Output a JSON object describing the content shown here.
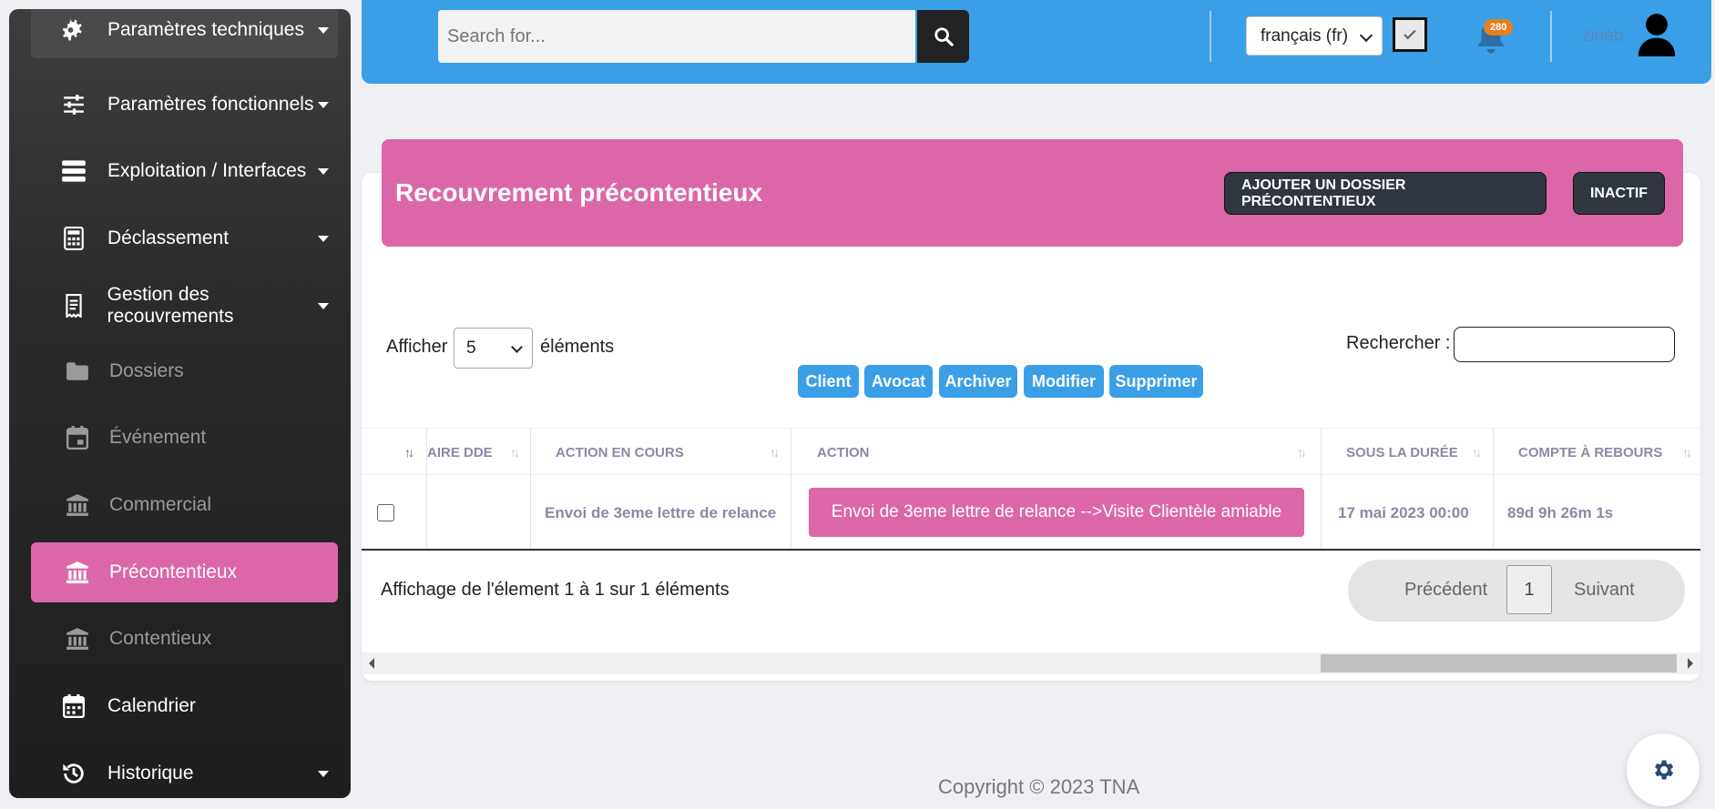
{
  "sidebar": {
    "items": [
      {
        "label": "Paramètres techniques",
        "icon": "gears-icon"
      },
      {
        "label": "Paramètres fonctionnels",
        "icon": "sliders-icon"
      },
      {
        "label": "Exploitation / Interfaces",
        "icon": "server-icon"
      },
      {
        "label": "Déclassement",
        "icon": "calculator-icon"
      },
      {
        "label": "Gestion des recouvrements",
        "icon": "receipt-icon"
      },
      {
        "label": "Dossiers",
        "icon": "folder-icon"
      },
      {
        "label": "Événement",
        "icon": "calendar-event-icon"
      },
      {
        "label": "Commercial",
        "icon": "bank-icon"
      },
      {
        "label": "Précontentieux",
        "icon": "bank-icon"
      },
      {
        "label": "Contentieux",
        "icon": "bank-icon"
      },
      {
        "label": "Calendrier",
        "icon": "calendar-icon"
      },
      {
        "label": "Historique",
        "icon": "history-icon"
      }
    ]
  },
  "header": {
    "search_placeholder": "Search for...",
    "language": "français (fr)",
    "notification_count": "280",
    "user_name": "zineb"
  },
  "banner": {
    "title": "Recouvrement précontentieux",
    "add_button": "AJOUTER UN DOSSIER PRÉCONTENTIEUX",
    "inactive_button": "INACTIF"
  },
  "table_controls": {
    "show_label": "Afficher",
    "page_length": "5",
    "elements_label": "éléments",
    "search_label": "Rechercher :",
    "actions": [
      "Client",
      "Avocat",
      "Archiver",
      "Modifier",
      "Supprimer"
    ]
  },
  "table": {
    "columns": [
      "AIRE DDE",
      "ACTION EN COURS",
      "ACTION",
      "SOUS LA DURÉE",
      "COMPTE À REBOURS"
    ],
    "rows": [
      {
        "aire_dde": "",
        "action_en_cours": "Envoi de 3eme lettre de relance",
        "action": "Envoi de 3eme lettre de relance -->Visite Clientèle amiable",
        "sous_la_duree": "17 mai 2023 00:00",
        "compte_a_rebours": "89d 9h 26m 1s"
      }
    ]
  },
  "footer_info": "Affichage de l'élement 1 à 1 sur 1 éléments",
  "pagination": {
    "prev": "Précédent",
    "current": "1",
    "next": "Suivant"
  },
  "copyright": "Copyright © 2023 TNA",
  "colors": {
    "accent_pink": "#dc67a8",
    "header_blue": "#3a9fe6",
    "dark_button": "#2f3640"
  }
}
